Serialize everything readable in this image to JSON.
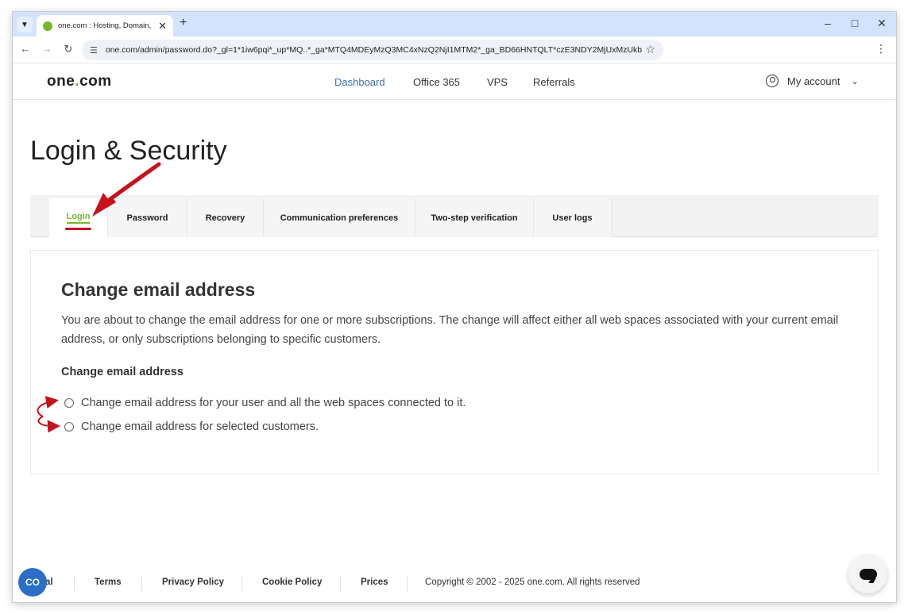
{
  "browser": {
    "tab_title": "one.com : Hosting, Domain, Email",
    "url": "one.com/admin/password.do?_gl=1*1iw6pqi*_up*MQ..*_ga*MTQ4MDEyMzQ3MC4xNzQ2NjI1MTM2*_ga_BD66HNTQLT*czE3NDY2MjUxMzUkb...",
    "icons": {
      "tab_list": "chevron-down-icon",
      "close_tab": "close-icon",
      "new_tab": "plus-icon",
      "back": "arrow-left-icon",
      "forward": "arrow-right-icon",
      "reload": "reload-icon",
      "site_info": "tune-icon",
      "bookmark": "star-icon",
      "menu": "kebab-menu-icon",
      "minimize": "minimize-icon",
      "maximize": "maximize-icon",
      "close_window": "close-window-icon"
    }
  },
  "header": {
    "logo_part1": "one",
    "logo_dot": ".",
    "logo_part2": "com",
    "nav": [
      "Dashboard",
      "Office 365",
      "VPS",
      "Referrals"
    ],
    "active_nav": "Dashboard",
    "account_label": "My account"
  },
  "page": {
    "title": "Login & Security",
    "tabs": [
      "Login",
      "Password",
      "Recovery",
      "Communication preferences",
      "Two-step verification",
      "User logs"
    ],
    "active_tab": "Login"
  },
  "card": {
    "heading": "Change email address",
    "description": "You are about to change the email address for one or more subscriptions. The change will affect either all web spaces associated with your current email address, or only subscriptions belonging to specific customers.",
    "subheading": "Change email address",
    "options": [
      "Change email address for your user and all the web spaces connected to it.",
      "Change email address for selected customers."
    ]
  },
  "footer": {
    "links": [
      "al",
      "Terms",
      "Privacy Policy",
      "Cookie Policy",
      "Prices"
    ],
    "copyright": "Copyright © 2002 - 2025 one.com. All rights reserved",
    "chat_badge": "CO"
  },
  "colors": {
    "brand_green": "#76b82a",
    "nav_active": "#3b73ad",
    "annotation_red": "#c6121d",
    "chrome_titlebar": "#d3e3fd"
  }
}
